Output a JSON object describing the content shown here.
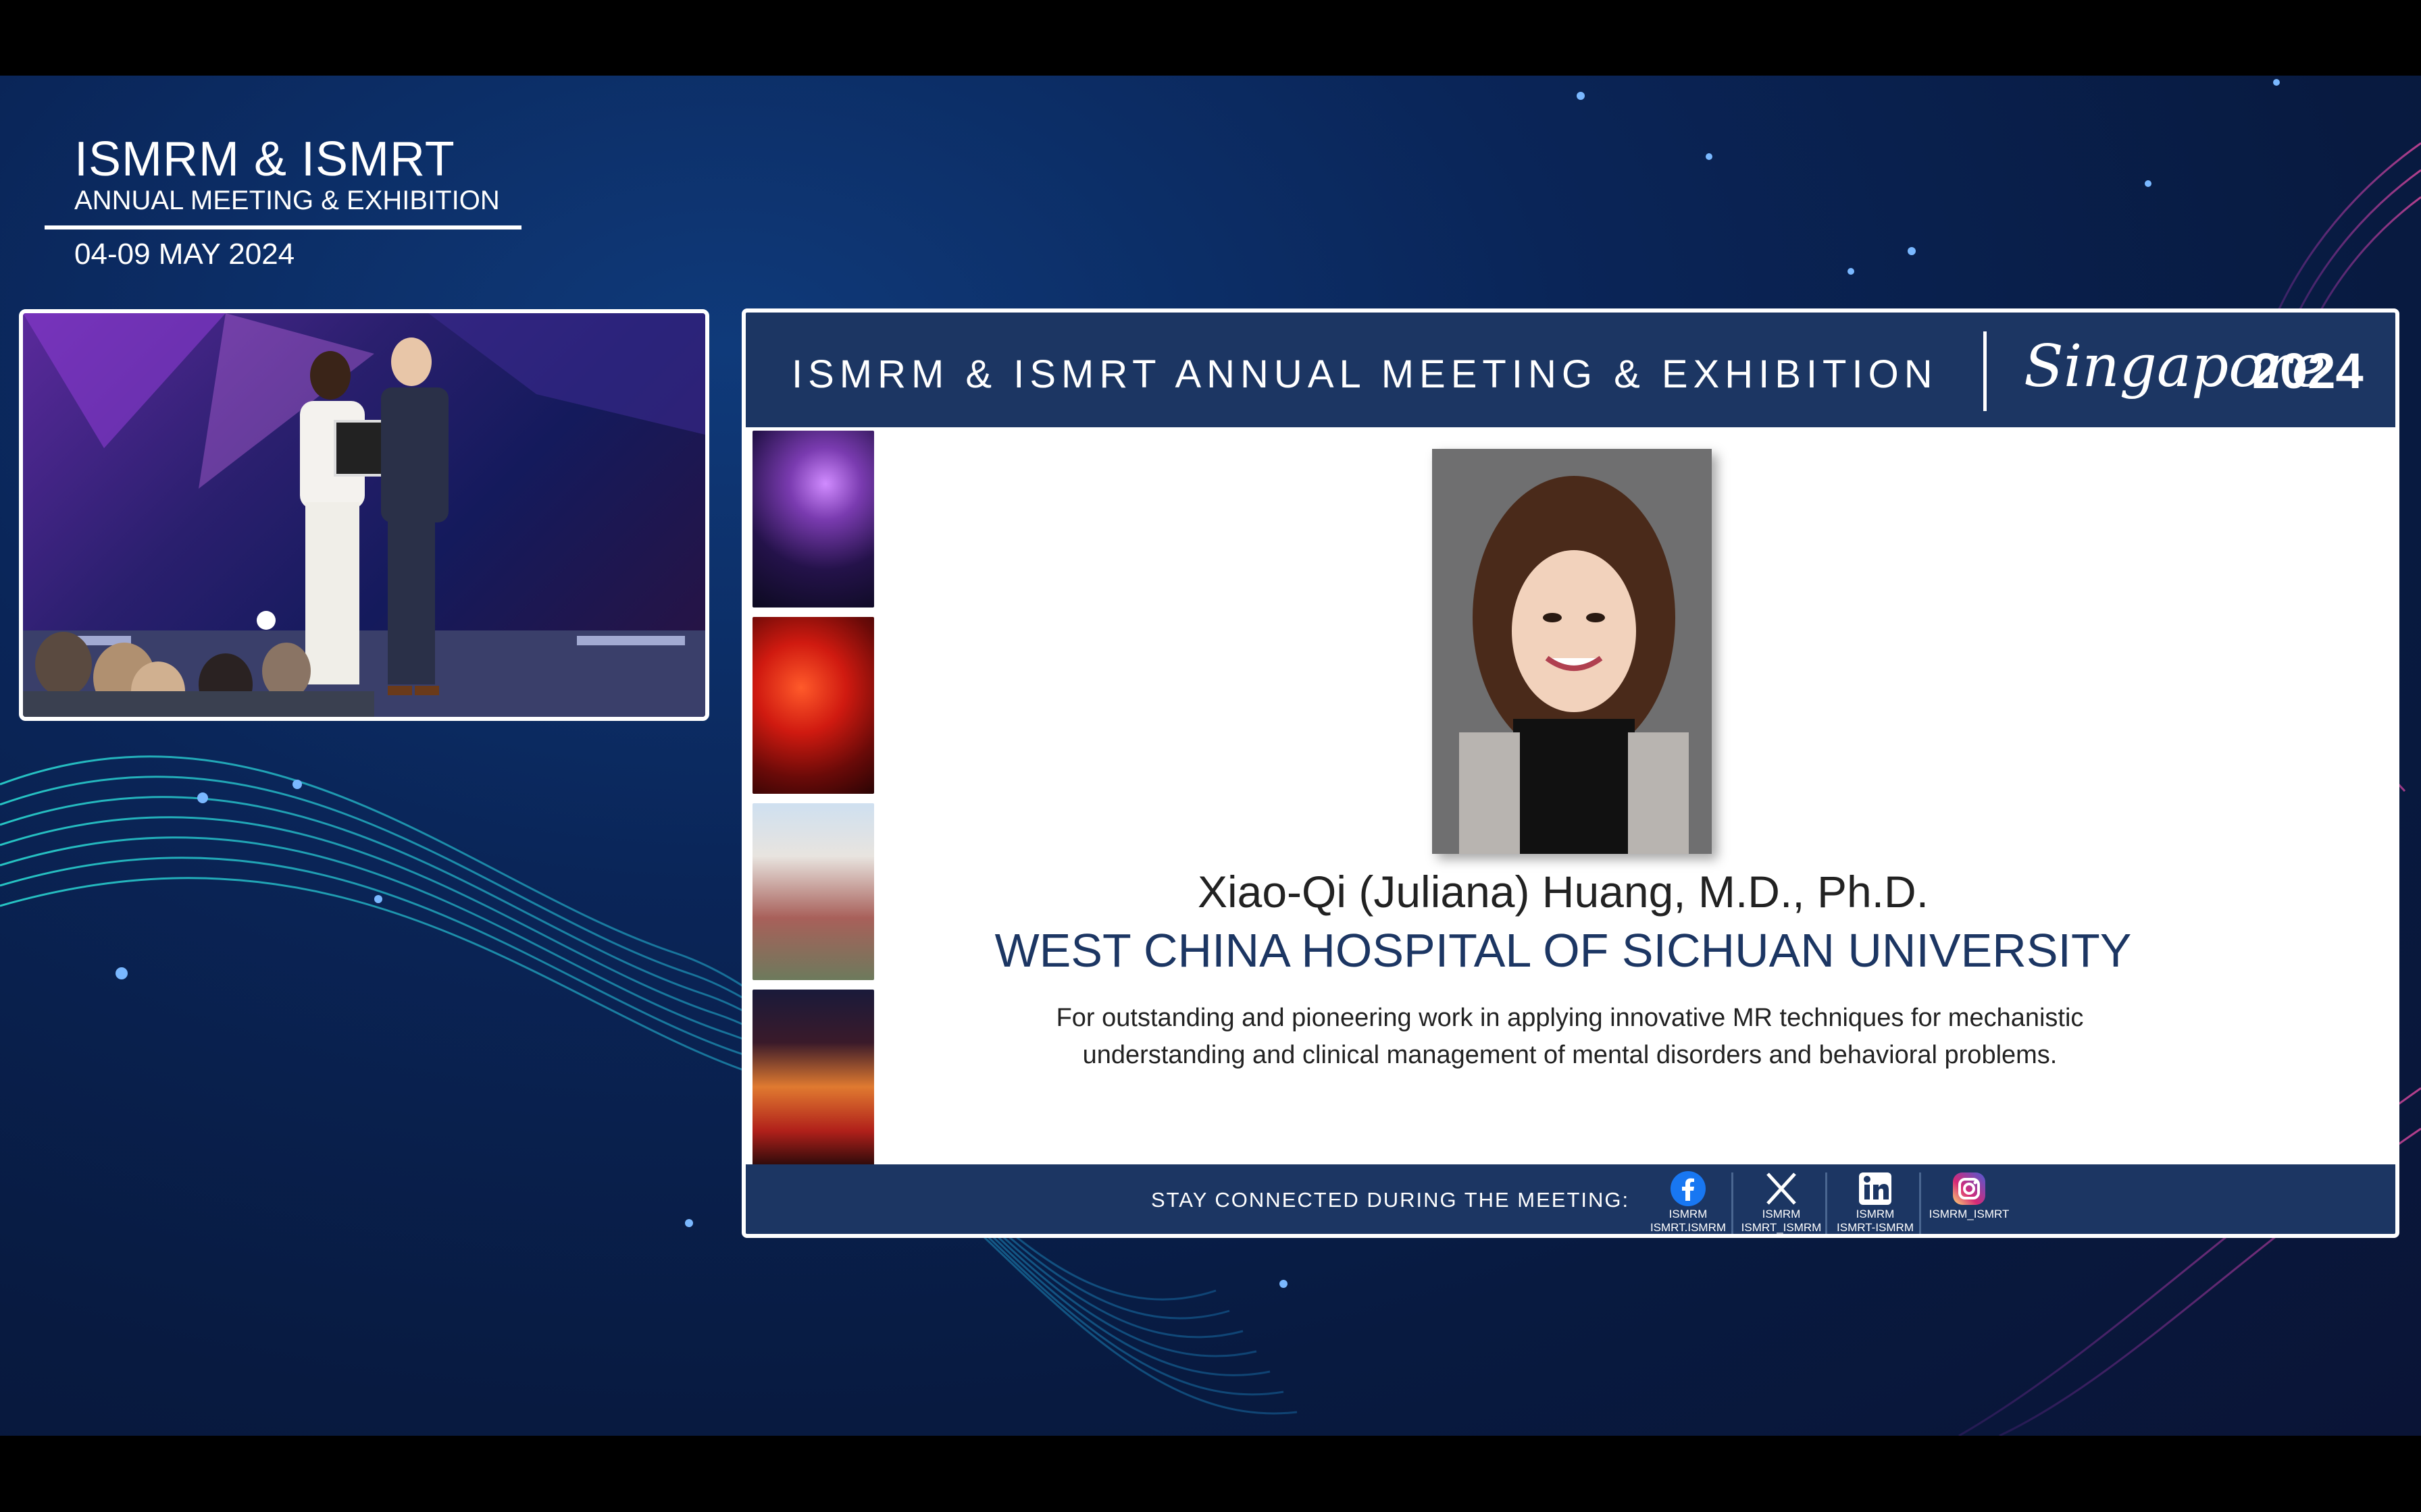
{
  "conference": {
    "title": "ISMRM & ISMRT",
    "subtitle": "ANNUAL MEETING & EXHIBITION",
    "dates": "04-09 MAY 2024"
  },
  "slide": {
    "header_title": "ISMRM & ISMRT ANNUAL MEETING & EXHIBITION",
    "header_city": "Singapore",
    "header_year": "2024",
    "awardee_name": "Xiao-Qi (Juliana) Huang, M.D., Ph.D.",
    "institution": "WEST CHINA HOSPITAL OF SICHUAN UNIVERSITY",
    "citation": "For outstanding and pioneering work in applying innovative MR techniques for mechanistic understanding and clinical management of mental disorders and behavioral problems.",
    "footer_label": "STAY CONNECTED DURING THE MEETING:",
    "socials": [
      {
        "icon": "facebook-icon",
        "line1": "ISMRM",
        "line2": "ISMRT.ISMRM"
      },
      {
        "icon": "x-icon",
        "line1": "ISMRM",
        "line2": "ISMRT_ISMRM"
      },
      {
        "icon": "linkedin-icon",
        "line1": "ISMRM",
        "line2": "ISMRT-ISMRM"
      },
      {
        "icon": "instagram-icon",
        "line1": "ISMRM_ISMRT",
        "line2": ""
      }
    ]
  },
  "colors": {
    "navy": "#1c3663",
    "background": "#0a2558",
    "accent_teal": "#2ad6d0"
  }
}
